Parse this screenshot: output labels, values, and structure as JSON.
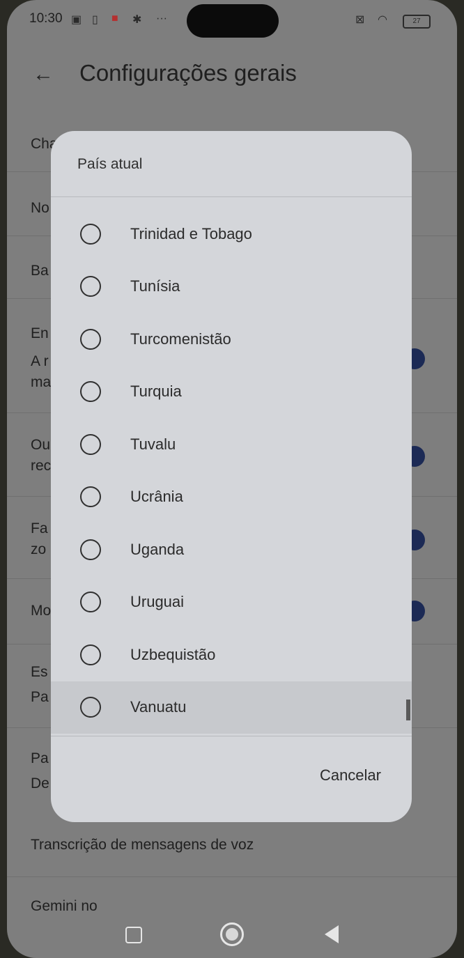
{
  "status_bar": {
    "time": "10:30",
    "icons": [
      "nfc-icon",
      "sim-icon",
      "mail-app-icon",
      "gear-icon",
      "more-icon",
      "mute-icon",
      "wifi-icon"
    ],
    "battery": "27"
  },
  "header": {
    "back_icon": "arrow-left-icon",
    "title": "Configurações gerais"
  },
  "background_rows": [
    "Cha",
    "No",
    "Ba",
    "En",
    "A r",
    "ma",
    "Ou",
    "rec",
    "Fa",
    "zo",
    "Mo",
    "Es",
    "Pa",
    "Pa",
    "De",
    "Transcrição de mensagens de voz",
    "Gemini no"
  ],
  "dialog": {
    "title": "País atual",
    "options": [
      "Trinidad e Tobago",
      "Tunísia",
      "Turcomenistão",
      "Turquia",
      "Tuvalu",
      "Ucrânia",
      "Uganda",
      "Uruguai",
      "Uzbequistão",
      "Vanuatu"
    ],
    "cancel_label": "Cancelar"
  },
  "nav_bar": {
    "recents_icon": "square-icon",
    "home_icon": "circle-icon",
    "back_icon": "triangle-back-icon"
  }
}
